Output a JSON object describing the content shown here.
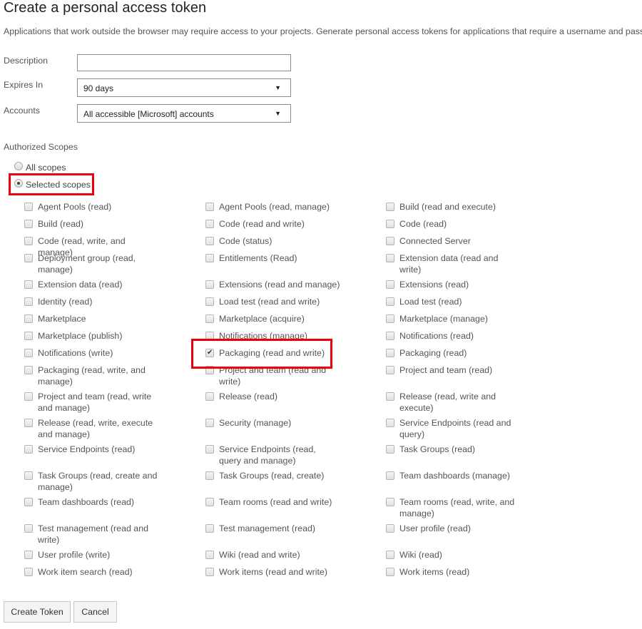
{
  "page": {
    "title": "Create a personal access token",
    "subtitle": "Applications that work outside the browser may require access to your projects. Generate personal access tokens for applications that require a username and password."
  },
  "form": {
    "description": {
      "label": "Description",
      "value": "",
      "placeholder": ""
    },
    "expires_in": {
      "label": "Expires In",
      "value": "90 days"
    },
    "accounts": {
      "label": "Accounts",
      "value": "All accessible [Microsoft] accounts"
    }
  },
  "authorized_scopes": {
    "label": "Authorized Scopes",
    "options": [
      {
        "label": "All scopes",
        "selected": false
      },
      {
        "label": "Selected scopes",
        "selected": true
      }
    ],
    "rows": [
      {
        "height": "single",
        "items": [
          {
            "label": "Agent Pools (read)",
            "checked": false
          },
          {
            "label": "Agent Pools (read, manage)",
            "checked": false
          },
          {
            "label": "Build (read and execute)",
            "checked": false
          }
        ]
      },
      {
        "height": "single",
        "items": [
          {
            "label": "Build (read)",
            "checked": false
          },
          {
            "label": "Code (read and write)",
            "checked": false
          },
          {
            "label": "Code (read)",
            "checked": false
          }
        ]
      },
      {
        "height": "single",
        "items": [
          {
            "label": "Code (read, write, and manage)",
            "checked": false
          },
          {
            "label": "Code (status)",
            "checked": false
          },
          {
            "label": "Connected Server",
            "checked": false
          }
        ]
      },
      {
        "height": "double",
        "items": [
          {
            "label": "Deployment group (read, manage)",
            "checked": false
          },
          {
            "label": "Entitlements (Read)",
            "checked": false
          },
          {
            "label": "Extension data (read and write)",
            "checked": false
          }
        ]
      },
      {
        "height": "single",
        "items": [
          {
            "label": "Extension data (read)",
            "checked": false
          },
          {
            "label": "Extensions (read and manage)",
            "checked": false
          },
          {
            "label": "Extensions (read)",
            "checked": false
          }
        ]
      },
      {
        "height": "single",
        "items": [
          {
            "label": "Identity (read)",
            "checked": false
          },
          {
            "label": "Load test (read and write)",
            "checked": false
          },
          {
            "label": "Load test (read)",
            "checked": false
          }
        ]
      },
      {
        "height": "single",
        "items": [
          {
            "label": "Marketplace",
            "checked": false
          },
          {
            "label": "Marketplace (acquire)",
            "checked": false
          },
          {
            "label": "Marketplace (manage)",
            "checked": false
          }
        ]
      },
      {
        "height": "single",
        "items": [
          {
            "label": "Marketplace (publish)",
            "checked": false
          },
          {
            "label": "Notifications (manage)",
            "checked": false
          },
          {
            "label": "Notifications (read)",
            "checked": false
          }
        ]
      },
      {
        "height": "single",
        "items": [
          {
            "label": "Notifications (write)",
            "checked": false
          },
          {
            "label": "Packaging (read and write)",
            "checked": true
          },
          {
            "label": "Packaging (read)",
            "checked": false
          }
        ]
      },
      {
        "height": "double",
        "items": [
          {
            "label": "Packaging (read, write, and manage)",
            "checked": false
          },
          {
            "label": "Project and team (read and write)",
            "checked": false
          },
          {
            "label": "Project and team (read)",
            "checked": false
          }
        ]
      },
      {
        "height": "double",
        "items": [
          {
            "label": "Project and team (read, write and manage)",
            "checked": false
          },
          {
            "label": "Release (read)",
            "checked": false
          },
          {
            "label": "Release (read, write and execute)",
            "checked": false
          }
        ]
      },
      {
        "height": "double",
        "items": [
          {
            "label": "Release (read, write, execute and manage)",
            "checked": false
          },
          {
            "label": "Security (manage)",
            "checked": false
          },
          {
            "label": "Service Endpoints (read and query)",
            "checked": false
          }
        ]
      },
      {
        "height": "double",
        "items": [
          {
            "label": "Service Endpoints (read)",
            "checked": false
          },
          {
            "label": "Service Endpoints (read, query and manage)",
            "checked": false
          },
          {
            "label": "Task Groups (read)",
            "checked": false
          }
        ]
      },
      {
        "height": "double",
        "items": [
          {
            "label": "Task Groups (read, create and manage)",
            "checked": false
          },
          {
            "label": "Task Groups (read, create)",
            "checked": false
          },
          {
            "label": "Team dashboards (manage)",
            "checked": false
          }
        ]
      },
      {
        "height": "double",
        "items": [
          {
            "label": "Team dashboards (read)",
            "checked": false
          },
          {
            "label": "Team rooms (read and write)",
            "checked": false
          },
          {
            "label": "Team rooms (read, write, and manage)",
            "checked": false
          }
        ]
      },
      {
        "height": "double",
        "items": [
          {
            "label": "Test management (read and write)",
            "checked": false
          },
          {
            "label": "Test management (read)",
            "checked": false
          },
          {
            "label": "User profile (read)",
            "checked": false
          }
        ]
      },
      {
        "height": "single",
        "items": [
          {
            "label": "User profile (write)",
            "checked": false
          },
          {
            "label": "Wiki (read and write)",
            "checked": false
          },
          {
            "label": "Wiki (read)",
            "checked": false
          }
        ]
      },
      {
        "height": "single",
        "items": [
          {
            "label": "Work item search (read)",
            "checked": false
          },
          {
            "label": "Work items (read and write)",
            "checked": false
          },
          {
            "label": "Work items (read)",
            "checked": false
          }
        ]
      }
    ]
  },
  "actions": {
    "create_label": "Create Token",
    "cancel_label": "Cancel"
  },
  "annotations": {
    "highlight_color": "#e8000b"
  }
}
